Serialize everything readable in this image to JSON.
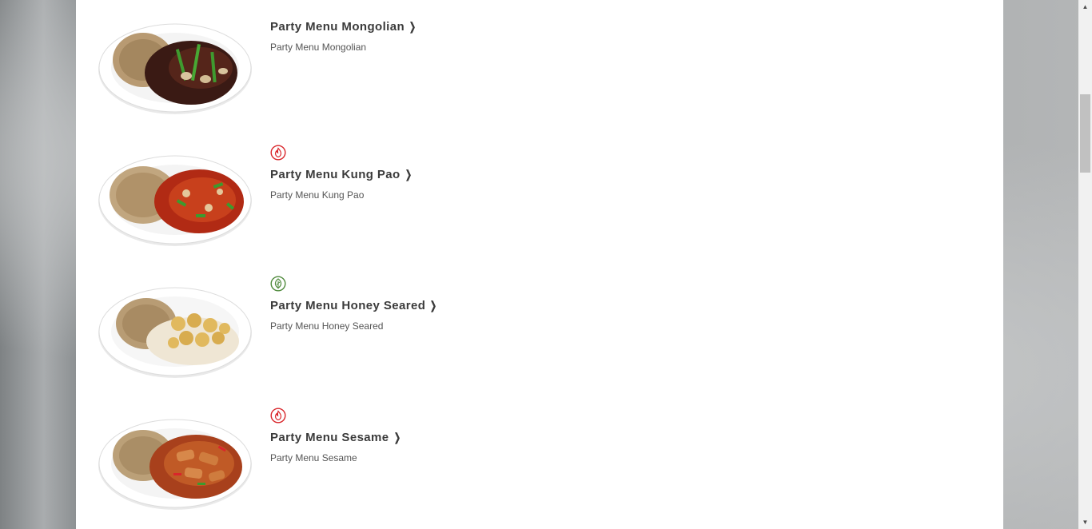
{
  "menu_items": [
    {
      "title": "Party Menu Mongolian",
      "description": "Party Menu Mongolian",
      "badge": null,
      "image_icon": "mongolian-beef-plate-image"
    },
    {
      "title": "Party Menu Kung Pao",
      "description": "Party Menu Kung Pao",
      "badge": "spicy-icon",
      "image_icon": "kung-pao-plate-image"
    },
    {
      "title": "Party Menu Honey Seared",
      "description": "Party Menu Honey Seared",
      "badge": "wok-smart-icon",
      "image_icon": "honey-seared-plate-image"
    },
    {
      "title": "Party Menu Sesame",
      "description": "Party Menu Sesame",
      "badge": "spicy-icon",
      "image_icon": "sesame-plate-image"
    }
  ],
  "colors": {
    "spicy_badge": "#d9262b",
    "wok_smart_badge": "#4f8a3c",
    "title_text": "#3b3b3b",
    "description_text": "#555555"
  }
}
